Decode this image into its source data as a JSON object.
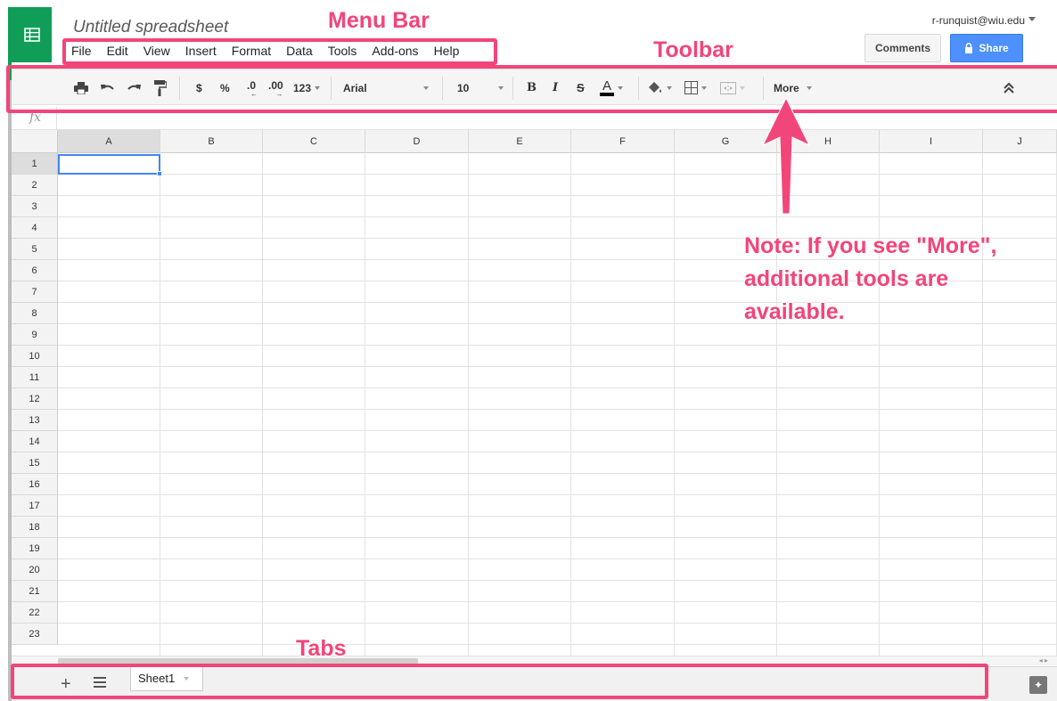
{
  "app": {
    "doc_title": "Untitled spreadsheet",
    "user_email": "r-runquist@wiu.edu",
    "logo_icon": "sheets-logo-icon"
  },
  "menu": {
    "items": [
      "File",
      "Edit",
      "View",
      "Insert",
      "Format",
      "Data",
      "Tools",
      "Add-ons",
      "Help"
    ]
  },
  "header_buttons": {
    "comments": "Comments",
    "share": "Share"
  },
  "toolbar": {
    "currency": "$",
    "percent": "%",
    "decrease_decimal": ".0",
    "increase_decimal": ".00",
    "number_format": "123",
    "font": "Arial",
    "font_size": "10",
    "bold": "B",
    "italic": "I",
    "strikethrough": "S",
    "text_color": "A",
    "more": "More"
  },
  "formula_bar": {
    "fx": "fx"
  },
  "grid": {
    "columns": [
      "A",
      "B",
      "C",
      "D",
      "E",
      "F",
      "G",
      "H",
      "I",
      "J"
    ],
    "rows": [
      "1",
      "2",
      "3",
      "4",
      "5",
      "6",
      "7",
      "8",
      "9",
      "10",
      "11",
      "12",
      "13",
      "14",
      "15",
      "16",
      "17",
      "18",
      "19",
      "20",
      "21",
      "22",
      "23"
    ],
    "active_cell": "A1"
  },
  "tabs": {
    "add": "+",
    "sheets": [
      "Sheet1"
    ]
  },
  "annotations": {
    "menu_bar": "Menu Bar",
    "toolbar": "Toolbar",
    "tabs": "Tabs",
    "note_line1": "Note: If you see \"More\",",
    "note_line2": "additional tools are",
    "note_line3": "available."
  },
  "colors": {
    "accent": "#0f9d58",
    "share": "#4d90fe",
    "annotation": "#f2457a",
    "selection": "#4285f4"
  }
}
